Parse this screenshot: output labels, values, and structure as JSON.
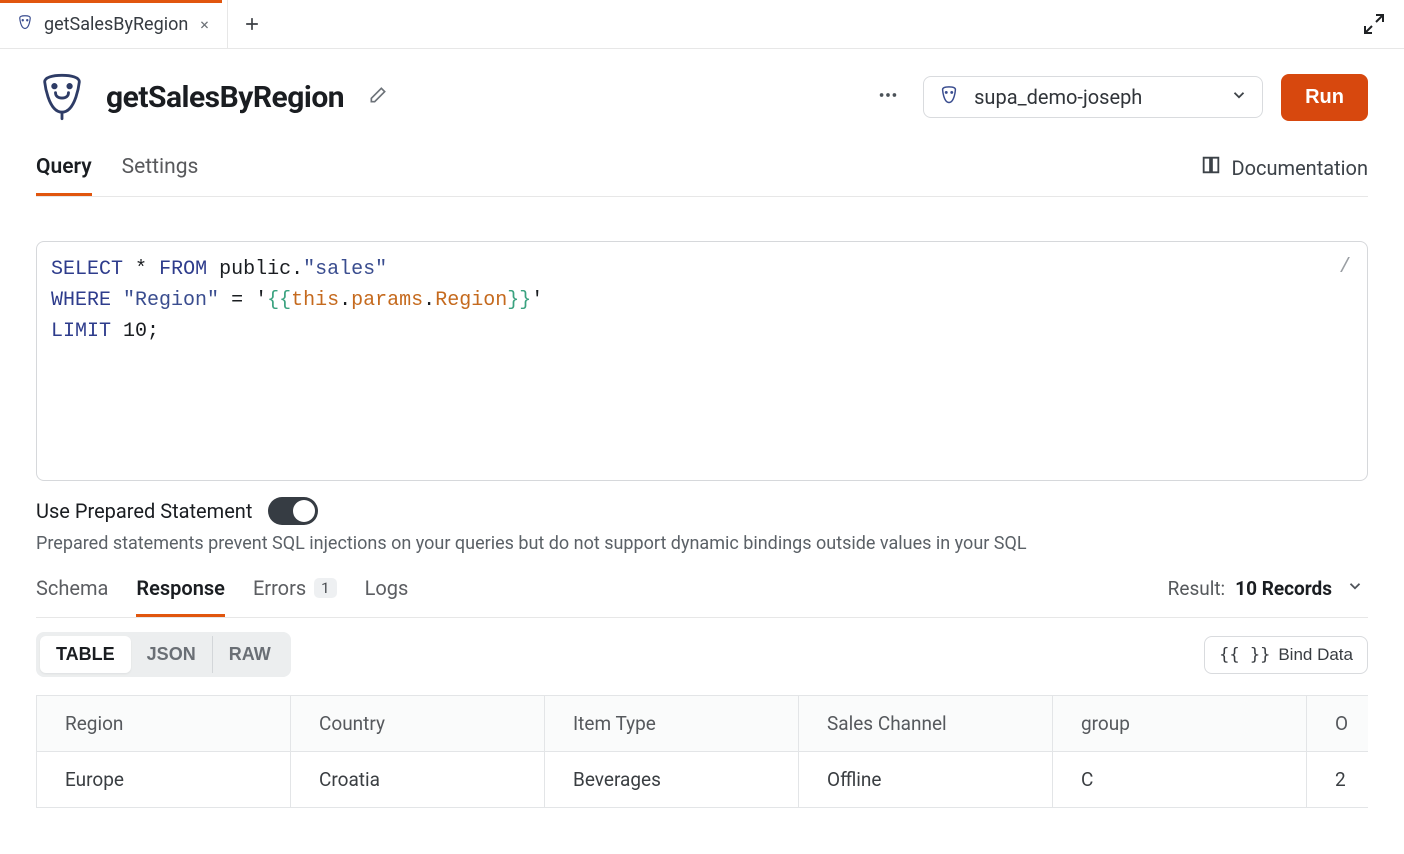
{
  "tabstrip": {
    "tab_label": "getSalesByRegion"
  },
  "header": {
    "title": "getSalesByRegion",
    "db_name": "supa_demo-joseph",
    "run_label": "Run"
  },
  "subtabs": {
    "query": "Query",
    "settings": "Settings",
    "documentation": "Documentation"
  },
  "editor": {
    "slash": "/",
    "sql_plain": "SELECT * FROM public.\"sales\"\nWHERE \"Region\" = '{{this.params.Region}}'\nLIMIT 10;"
  },
  "prep": {
    "label": "Use Prepared Statement",
    "desc": "Prepared statements prevent SQL injections on your queries but do not support dynamic bindings outside values in your SQL"
  },
  "restabs": {
    "schema": "Schema",
    "response": "Response",
    "errors": "Errors",
    "errors_count": "1",
    "logs": "Logs",
    "result_prefix": "Result: ",
    "result_count": "10 Records"
  },
  "view": {
    "table": "TABLE",
    "json": "JSON",
    "raw": "RAW",
    "bind": "Bind Data",
    "bind_glyph": "{{ }}"
  },
  "table": {
    "headers": [
      "Region",
      "Country",
      "Item Type",
      "Sales Channel",
      "group",
      "O"
    ],
    "rows": [
      [
        "Europe",
        "Croatia",
        "Beverages",
        "Offline",
        "C",
        "2"
      ]
    ]
  }
}
